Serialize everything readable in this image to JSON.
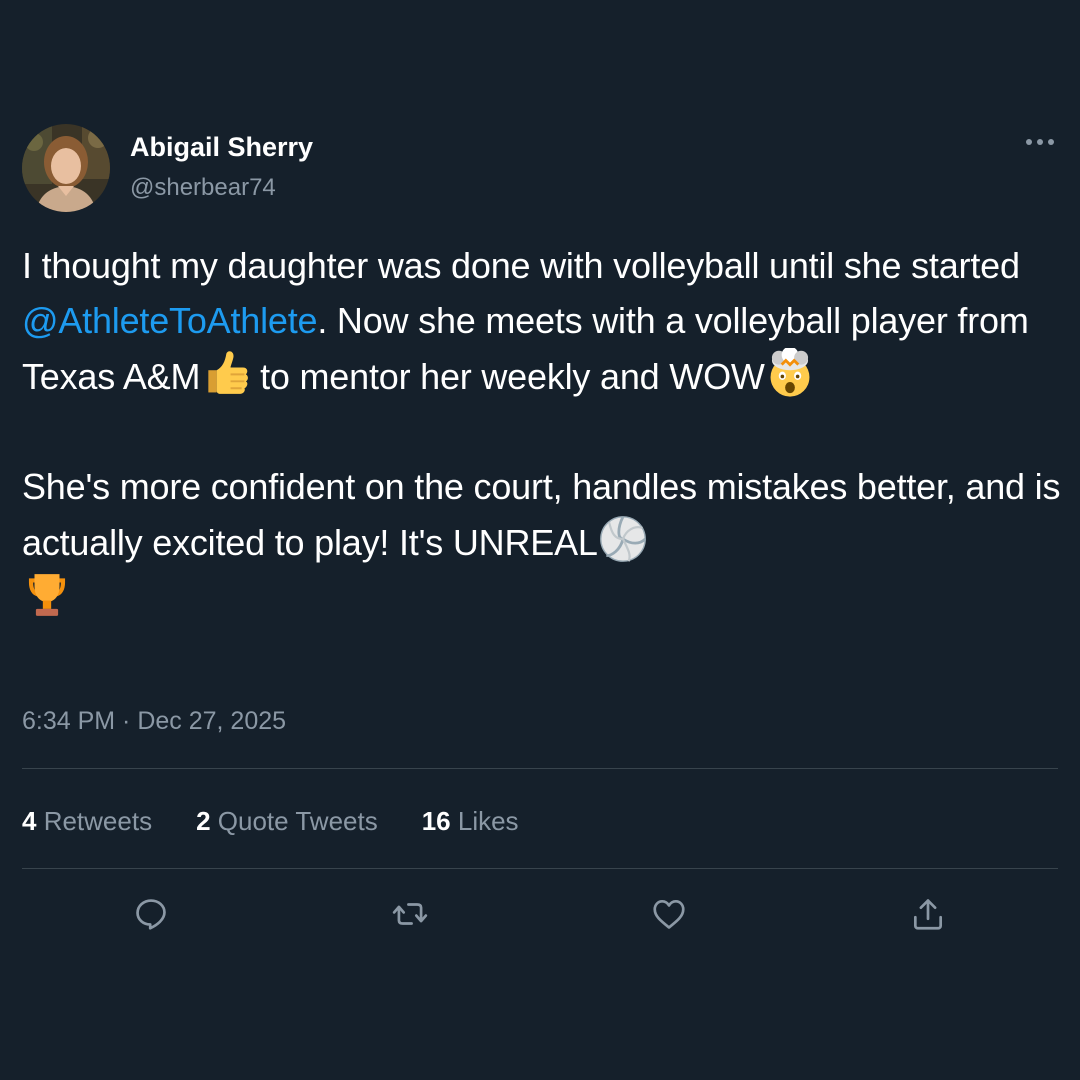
{
  "author": {
    "display_name": "Abigail Sherry",
    "handle": "@sherbear74"
  },
  "tweet": {
    "p1_a": "I thought my daughter was done with volleyball until she started ",
    "p1_mention": "@AthleteToAthlete",
    "p1_b": ". Now she meets with a volleyball player from Texas A&M",
    "p1_c": " to mentor her weekly and WOW",
    "p2_a": "She's more confident on the court, handles mistakes better, and is actually excited to play! It's UNREAL",
    "emojis": [
      "thumbs-up-emoji",
      "exploding-head-emoji",
      "volleyball-emoji",
      "trophy-emoji"
    ]
  },
  "timestamp": "6:34 PM · Dec 27, 2025",
  "stats": {
    "retweets_count": "4",
    "retweets_label": " Retweets",
    "quotes_count": "2",
    "quotes_label": " Quote Tweets",
    "likes_count": "16",
    "likes_label": " Likes"
  },
  "actions": [
    "reply-icon",
    "retweet-icon",
    "like-icon",
    "share-icon"
  ],
  "colors": {
    "background": "#15202b",
    "text": "#ffffff",
    "secondary": "#8b98a5",
    "accent": "#1d9bf0",
    "divider": "#38444d"
  }
}
